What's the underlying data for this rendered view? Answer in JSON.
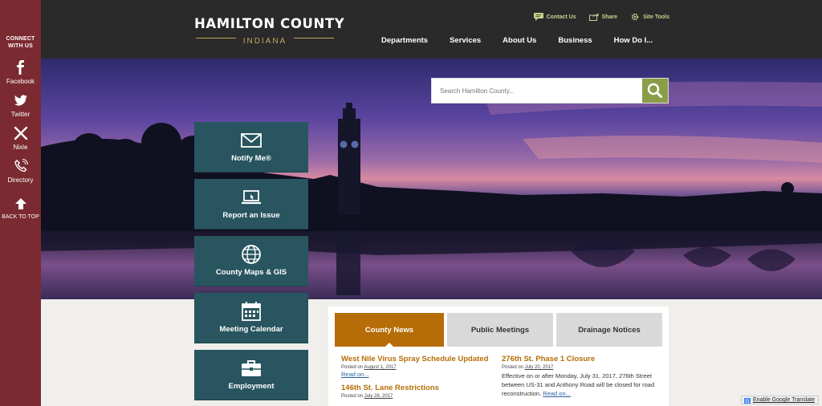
{
  "social": {
    "connect_line1": "CONNECT",
    "connect_line2": "WITH US",
    "items": [
      {
        "label": "Facebook",
        "icon": "facebook-icon"
      },
      {
        "label": "Twitter",
        "icon": "twitter-icon"
      },
      {
        "label": "Nixle",
        "icon": "nixle-icon"
      },
      {
        "label": "Directory",
        "icon": "phone-icon"
      }
    ],
    "back_to_top": "BACK TO TOP"
  },
  "header": {
    "logo_line1": "HAMILTON COUNTY",
    "logo_line2": "INDIANA",
    "tools": [
      {
        "label": "Contact Us",
        "icon": "chat-icon"
      },
      {
        "label": "Share",
        "icon": "share-icon"
      },
      {
        "label": "Site Tools",
        "icon": "gear-icon"
      }
    ],
    "nav": [
      "Departments",
      "Services",
      "About Us",
      "Business",
      "How Do I..."
    ]
  },
  "search": {
    "placeholder": "Search Hamilton County..."
  },
  "tiles": [
    {
      "label": "Notify Me®",
      "icon": "envelope-icon"
    },
    {
      "label": "Report an Issue",
      "icon": "laptop-icon"
    },
    {
      "label": "County Maps & GIS",
      "icon": "globe-icon"
    },
    {
      "label": "Meeting Calendar",
      "icon": "calendar-icon"
    },
    {
      "label": "Employment",
      "icon": "briefcase-icon"
    }
  ],
  "news": {
    "tabs": [
      "County News",
      "Public Meetings",
      "Drainage Notices"
    ],
    "items": [
      {
        "title": "West Nile Virus Spray Schedule Updated",
        "posted_prefix": "Posted on ",
        "date": "August 1, 2017",
        "read_more": "Read on..."
      },
      {
        "title": "146th St. Lane Restrictions",
        "posted_prefix": "Posted on ",
        "date": "July 28, 2017"
      },
      {
        "title": "276th St. Phase 1 Closure",
        "posted_prefix": "Posted on ",
        "date": "July 20, 2017",
        "body": "Effective on or after Monday, July 31, 2017, 276th Street between US-31 and Anthony Road will be closed for road reconstruction.",
        "read_more": "Read on..."
      }
    ]
  },
  "translate": {
    "label": "Enable Google Translate"
  },
  "colors": {
    "sidebar": "#7a2a30",
    "header": "#2b2a2b",
    "tile": "#28555f",
    "accent_orange": "#b66d08",
    "search_button": "#8a9e4a"
  }
}
